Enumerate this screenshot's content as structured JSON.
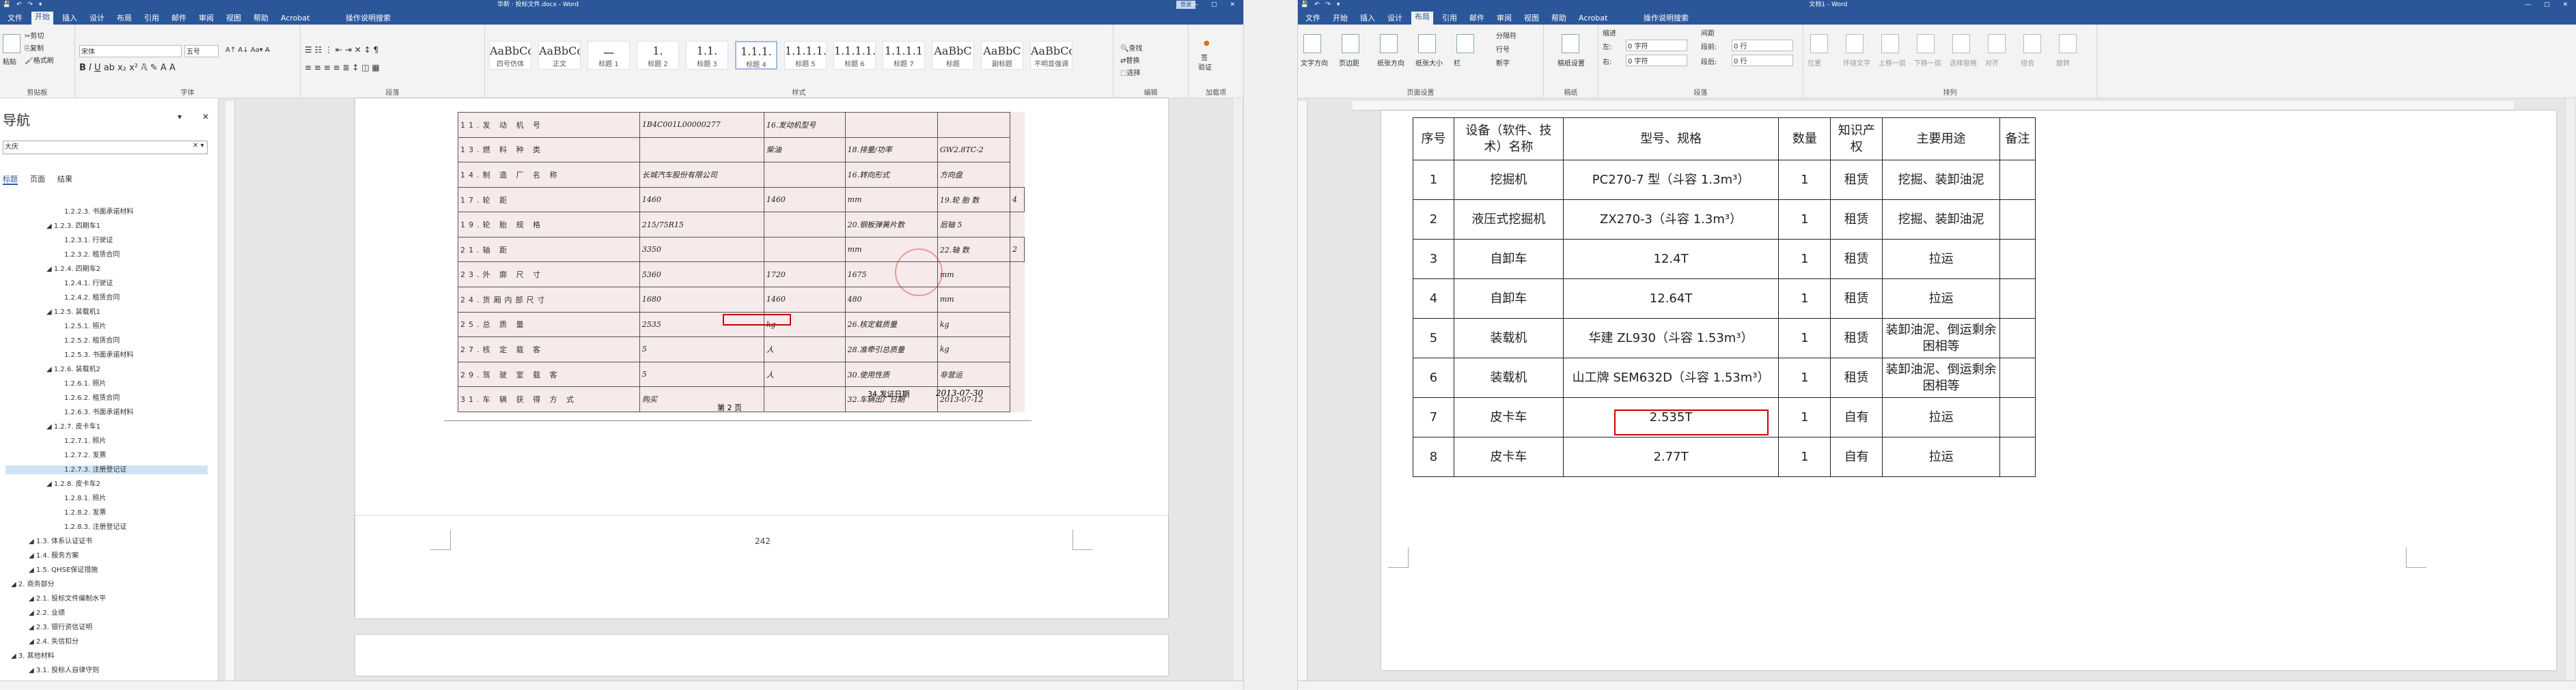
{
  "left": {
    "title": "华新 · 投标文件.docx - Word",
    "sign_in": "登录",
    "tabs": [
      "文件",
      "开始",
      "插入",
      "设计",
      "布局",
      "引用",
      "邮件",
      "审阅",
      "视图",
      "帮助",
      "Acrobat",
      "操作说明搜索"
    ],
    "ribbon": {
      "clipboard": {
        "cut": "剪切",
        "copy": "复制",
        "format_painter": "格式刷",
        "label": "剪贴板",
        "paste": "粘贴"
      },
      "font": {
        "name": "宋体",
        "size": "五号",
        "label": "字体"
      },
      "paragraph": {
        "label": "段落"
      },
      "styles": {
        "label": "样式",
        "items": [
          {
            "preview": "AaBbCc",
            "name": "四号仿体"
          },
          {
            "preview": "AaBbCcD",
            "name": "正文"
          },
          {
            "preview": "一",
            "name": "标题 1"
          },
          {
            "preview": "1.",
            "name": "标题 2"
          },
          {
            "preview": "1.1.",
            "name": "标题 3"
          },
          {
            "preview": "1.1.1.",
            "name": "标题 4"
          },
          {
            "preview": "1.1.1.1.",
            "name": "标题 5"
          },
          {
            "preview": "1.1.1.1.1.",
            "name": "标题 6"
          },
          {
            "preview": "1.1.1.1",
            "name": "标题 7"
          },
          {
            "preview": "AaBbC",
            "name": "标题"
          },
          {
            "preview": "AaBbC",
            "name": "副标题"
          },
          {
            "preview": "AaBbCcD",
            "name": "不明显强调"
          }
        ]
      },
      "editing": {
        "find": "查找",
        "replace": "替换",
        "select": "选择",
        "label": "编辑"
      },
      "sign": {
        "line1": "签",
        "line2": "验证",
        "label": "加载项"
      }
    },
    "nav": {
      "title": "导航",
      "search": "大庆",
      "tabs": [
        "标题",
        "页面",
        "结果"
      ],
      "items": [
        {
          "label": "1.2.2.3. 书面承诺材料",
          "indent": 2
        },
        {
          "label": "1.2.3. 四期车1",
          "indent": 1
        },
        {
          "label": "1.2.3.1. 行驶证",
          "indent": 2
        },
        {
          "label": "1.2.3.2. 租赁合同",
          "indent": 2
        },
        {
          "label": "1.2.4. 四期车2",
          "indent": 1
        },
        {
          "label": "1.2.4.1. 行驶证",
          "indent": 2
        },
        {
          "label": "1.2.4.2. 租赁合同",
          "indent": 2
        },
        {
          "label": "1.2.5. 装载机1",
          "indent": 1
        },
        {
          "label": "1.2.5.1. 照片",
          "indent": 2
        },
        {
          "label": "1.2.5.2. 租赁合同",
          "indent": 2
        },
        {
          "label": "1.2.5.3. 书面承诺材料",
          "indent": 2
        },
        {
          "label": "1.2.6. 装载机2",
          "indent": 1
        },
        {
          "label": "1.2.6.1. 照片",
          "indent": 2
        },
        {
          "label": "1.2.6.2. 租赁合同",
          "indent": 2
        },
        {
          "label": "1.2.6.3. 书面承诺材料",
          "indent": 2
        },
        {
          "label": "1.2.7. 皮卡车1",
          "indent": 1
        },
        {
          "label": "1.2.7.1. 照片",
          "indent": 2
        },
        {
          "label": "1.2.7.2. 发票",
          "indent": 2
        },
        {
          "label": "1.2.7.3. 注册登记证",
          "indent": 2,
          "selected": true
        },
        {
          "label": "1.2.8. 皮卡车2",
          "indent": 1
        },
        {
          "label": "1.2.8.1. 照片",
          "indent": 2
        },
        {
          "label": "1.2.8.2. 发票",
          "indent": 2
        },
        {
          "label": "1.2.8.3. 注册登记证",
          "indent": 2
        },
        {
          "label": "1.3. 体系认证证书",
          "indent": 0
        },
        {
          "label": "1.4. 服务方案",
          "indent": 0
        },
        {
          "label": "1.5. QHSE保证措施",
          "indent": 0
        },
        {
          "label": "2. 商务部分",
          "indent": -1
        },
        {
          "label": "2.1. 投标文件编制水平",
          "indent": 0
        },
        {
          "label": "2.2. 业绩",
          "indent": 0
        },
        {
          "label": "2.3. 银行资信证明",
          "indent": 0
        },
        {
          "label": "2.4. 失信扣分",
          "indent": 0
        },
        {
          "label": "3. 其他材料",
          "indent": -1
        },
        {
          "label": "3.1. 投标人自律守则",
          "indent": 0
        }
      ]
    },
    "scan": {
      "rows": [
        [
          "11.发 动 机 号",
          "1B4C001L00000277",
          "16.发动机型号",
          "",
          ""
        ],
        [
          "13.燃 料 种 类",
          "",
          "柴油",
          "18.排量/功率",
          "GW2.8TC-2"
        ],
        [
          "14.制 造 厂 名 称",
          "长城汽车股份有限公司",
          "",
          "16.转向形式",
          "方向盘"
        ],
        [
          "17.轮 距",
          "1460",
          "1460",
          "mm",
          "19.轮 胎 数",
          "4"
        ],
        [
          "19.轮 胎 规 格",
          "215/75R15",
          "",
          "20.钢板弹簧片数",
          "后轴 5"
        ],
        [
          "21.轴 距",
          "3350",
          "",
          "mm",
          "22.轴 数",
          "2"
        ],
        [
          "23.外 廓 尺 寸",
          "5360",
          "1720",
          "1675",
          "mm"
        ],
        [
          "24.货厢内部尺寸",
          "1680",
          "1460",
          "480",
          "mm"
        ],
        [
          "25.总 质 量",
          "2535",
          "kg",
          "26.核定载质量",
          "kg"
        ],
        [
          "27.核 定 载 客",
          "5",
          "人",
          "28.准牵引总质量",
          "kg"
        ],
        [
          "29.驾 驶 室 载 客",
          "5",
          "人",
          "30.使用性质",
          "非营运"
        ],
        [
          "31.车 辆 获 得 方 式",
          "购买",
          "",
          "32.车辆出厂日期",
          "2013-07-12"
        ]
      ],
      "issue_date_label": "34.发证日期",
      "issue_date": "2013-07-30",
      "footer": "第 2 页",
      "page_number": "242"
    }
  },
  "right": {
    "title": "文档1 - Word",
    "share": "共享",
    "tabs": [
      "文件",
      "开始",
      "插入",
      "设计",
      "布局",
      "引用",
      "邮件",
      "审阅",
      "视图",
      "帮助",
      "Acrobat",
      "操作说明搜索"
    ],
    "ribbon": {
      "page_setup": {
        "label": "页面设置",
        "items": [
          "文字方向",
          "页边距",
          "纸张方向",
          "纸张大小",
          "栏"
        ],
        "small": [
          "分隔符",
          "行号",
          "断字"
        ]
      },
      "manuscript": {
        "label": "稿纸",
        "item": "稿纸设置"
      },
      "paragraph": {
        "label": "段落",
        "indent": "缩进",
        "spacing": "间距",
        "left": "左:",
        "right": "右:",
        "before": "段前:",
        "after": "段后:",
        "left_val": "0 字符",
        "right_val": "0 字符",
        "before_val": "0 行",
        "after_val": "0 行"
      },
      "arrange": {
        "label": "排列",
        "items": [
          "位置",
          "环绕文字",
          "上移一层",
          "下移一层",
          "选择窗格",
          "对齐",
          "组合",
          "旋转"
        ]
      }
    },
    "table": {
      "headers": [
        "序号",
        "设备（软件、技术）名称",
        "型号、规格",
        "数量",
        "知识产权",
        "主要用途",
        "备注"
      ],
      "rows": [
        [
          "1",
          "挖掘机",
          "PC270-7 型（斗容 1.3m³）",
          "1",
          "租赁",
          "挖掘、装卸油泥",
          ""
        ],
        [
          "2",
          "液压式挖掘机",
          "ZX270-3（斗容 1.3m³）",
          "1",
          "租赁",
          "挖掘、装卸油泥",
          ""
        ],
        [
          "3",
          "自卸车",
          "12.4T",
          "1",
          "租赁",
          "拉运",
          ""
        ],
        [
          "4",
          "自卸车",
          "12.64T",
          "1",
          "租赁",
          "拉运",
          ""
        ],
        [
          "5",
          "装载机",
          "华建 ZL930（斗容 1.53m³）",
          "1",
          "租赁",
          "装卸油泥、倒运剩余困相等",
          ""
        ],
        [
          "6",
          "装载机",
          "山工牌 SEM632D（斗容 1.53m³）",
          "1",
          "租赁",
          "装卸油泥、倒运剩余困相等",
          ""
        ],
        [
          "7",
          "皮卡车",
          "2.535T",
          "1",
          "自有",
          "拉运",
          ""
        ],
        [
          "8",
          "皮卡车",
          "2.77T",
          "1",
          "自有",
          "拉运",
          ""
        ]
      ]
    }
  }
}
